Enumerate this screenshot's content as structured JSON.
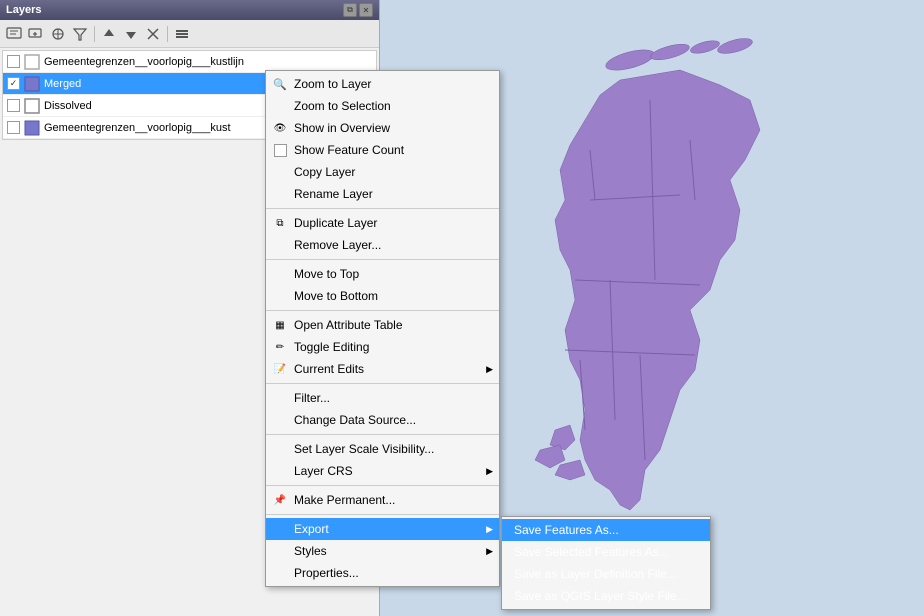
{
  "window": {
    "title": "Layers"
  },
  "toolbar": {
    "buttons": [
      "add-layer",
      "add-wms",
      "digitize",
      "filter",
      "move",
      "zoom-full",
      "zoom-layer",
      "zoom-selection",
      "refresh",
      "settings"
    ]
  },
  "layers": [
    {
      "id": 1,
      "name": "Gemeentegrenzen__voorlopig___kustlijn",
      "checked": false,
      "type": "polygon",
      "color": "#aaaaaa"
    },
    {
      "id": 2,
      "name": "Merged",
      "checked": true,
      "type": "polygon",
      "color": "#7777cc",
      "selected": true
    },
    {
      "id": 3,
      "name": "Dissolved",
      "checked": false,
      "type": "polygon",
      "color": "#888888"
    },
    {
      "id": 4,
      "name": "Gemeentegrenzen__voorlopig___kust",
      "checked": false,
      "type": "polygon",
      "color": "#7777cc"
    }
  ],
  "context_menu": {
    "items": [
      {
        "id": "zoom-to-layer",
        "label": "Zoom to Layer",
        "icon": "🔍",
        "has_icon": true
      },
      {
        "id": "zoom-to-selection",
        "label": "Zoom to Selection",
        "icon": "",
        "has_icon": false
      },
      {
        "id": "show-in-overview",
        "label": "Show in Overview",
        "icon": "👁",
        "has_icon": true
      },
      {
        "id": "show-feature-count",
        "label": "Show Feature Count",
        "icon": "",
        "has_checkbox": true
      },
      {
        "id": "copy-layer",
        "label": "Copy Layer",
        "icon": "",
        "has_icon": false
      },
      {
        "id": "rename-layer",
        "label": "Rename Layer",
        "icon": "",
        "has_icon": false
      },
      {
        "id": "separator1"
      },
      {
        "id": "duplicate-layer",
        "label": "Duplicate Layer",
        "icon": "📋",
        "has_icon": true
      },
      {
        "id": "remove-layer",
        "label": "Remove Layer...",
        "icon": "",
        "has_icon": false
      },
      {
        "id": "separator2"
      },
      {
        "id": "move-to-top",
        "label": "Move to Top",
        "icon": "",
        "has_icon": false
      },
      {
        "id": "move-to-bottom",
        "label": "Move to Bottom",
        "icon": "",
        "has_icon": false
      },
      {
        "id": "separator3"
      },
      {
        "id": "open-attribute-table",
        "label": "Open Attribute Table",
        "icon": "📊",
        "has_icon": true
      },
      {
        "id": "toggle-editing",
        "label": "Toggle Editing",
        "icon": "✏️",
        "has_icon": true
      },
      {
        "id": "current-edits",
        "label": "Current Edits",
        "icon": "📝",
        "has_icon": true,
        "has_submenu": true
      },
      {
        "id": "separator4"
      },
      {
        "id": "filter",
        "label": "Filter...",
        "icon": "",
        "has_icon": false
      },
      {
        "id": "change-data-source",
        "label": "Change Data Source...",
        "icon": "",
        "has_icon": false
      },
      {
        "id": "separator5"
      },
      {
        "id": "set-layer-scale",
        "label": "Set Layer Scale Visibility...",
        "icon": "",
        "has_icon": false
      },
      {
        "id": "layer-crs",
        "label": "Layer CRS",
        "icon": "",
        "has_submenu": true
      },
      {
        "id": "separator6"
      },
      {
        "id": "make-permanent",
        "label": "Make Permanent...",
        "icon": "📌",
        "has_icon": true
      },
      {
        "id": "separator7"
      },
      {
        "id": "export",
        "label": "Export",
        "icon": "",
        "has_submenu": true,
        "active": true
      },
      {
        "id": "styles",
        "label": "Styles",
        "icon": "",
        "has_submenu": true
      },
      {
        "id": "properties",
        "label": "Properties...",
        "icon": "",
        "has_icon": false
      }
    ]
  },
  "submenu": {
    "title": "Export",
    "items": [
      {
        "id": "save-features-as",
        "label": "Save Features As...",
        "active": true
      },
      {
        "id": "save-selected-features-as",
        "label": "Save Selected Features As..."
      },
      {
        "id": "save-as-layer-definition",
        "label": "Save as Layer Definition File..."
      },
      {
        "id": "save-as-qgis-style",
        "label": "Save as QGIS Layer Style File..."
      }
    ]
  },
  "colors": {
    "selected_blue": "#3399ff",
    "menu_bg": "#f5f5f5",
    "panel_bg": "#f0f0f0",
    "map_bg": "#c8d8e8",
    "netherlands_fill": "#9b7fc9",
    "titlebar_grad_start": "#6a6a8a",
    "titlebar_grad_end": "#4a4a6a"
  }
}
